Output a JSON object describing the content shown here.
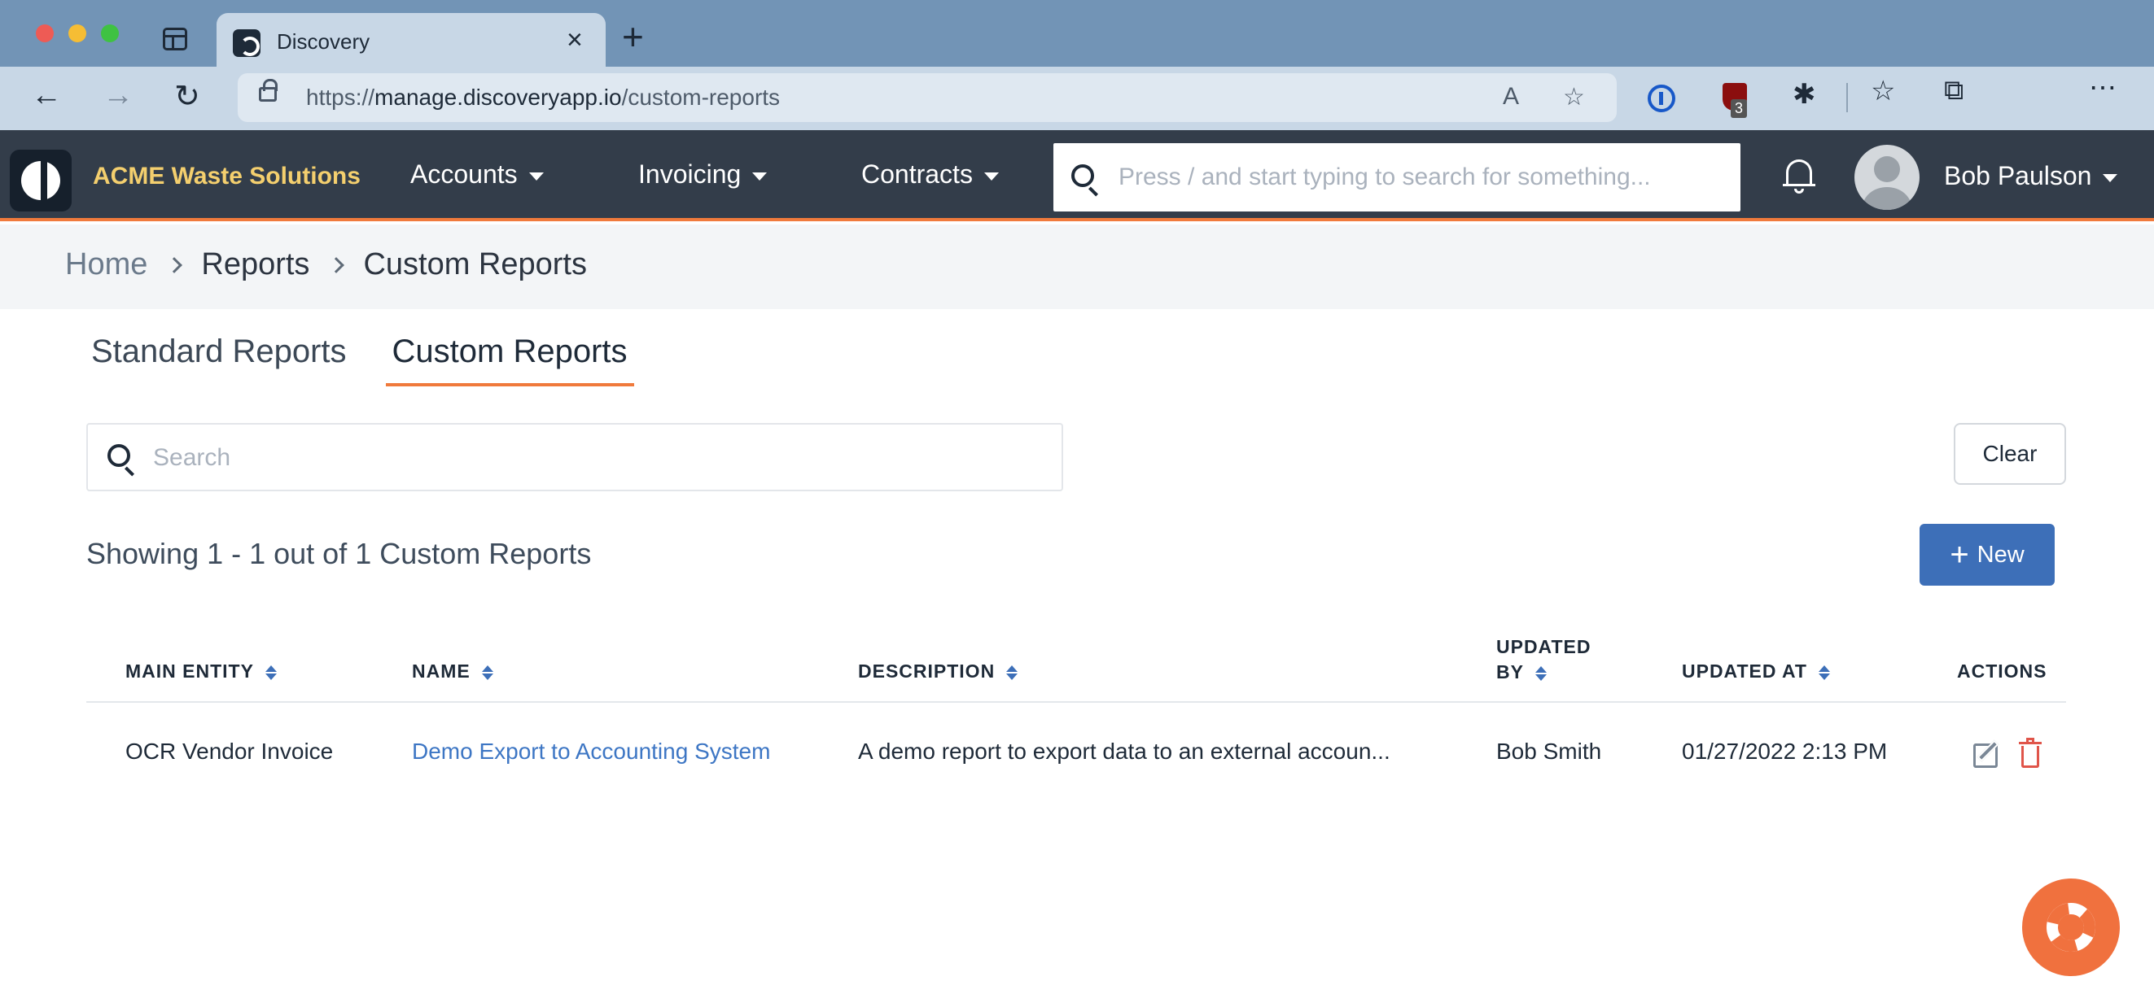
{
  "browser": {
    "tab_title": "Discovery",
    "url_prefix": "https://",
    "url_host": "manage.discoveryapp.io",
    "url_path": "/custom-reports",
    "extension_badge": "3",
    "icons": [
      "sidebar-icon",
      "back-icon",
      "forward-icon",
      "reload-icon",
      "lock-icon",
      "read-aloud-icon",
      "favorite-add-icon",
      "1password-icon",
      "ublock-icon",
      "extensions-icon",
      "favorites-icon",
      "collections-icon",
      "more-icon"
    ]
  },
  "header": {
    "company": "ACME Waste Solutions",
    "nav": [
      {
        "label": "Accounts"
      },
      {
        "label": "Invoicing"
      },
      {
        "label": "Contracts"
      }
    ],
    "search_placeholder": "Press / and start typing to search for something...",
    "user_name": "Bob Paulson",
    "accent_color": "#f07a3c"
  },
  "breadcrumb": [
    "Home",
    "Reports",
    "Custom Reports"
  ],
  "tabs": [
    {
      "label": "Standard Reports",
      "active": false
    },
    {
      "label": "Custom Reports",
      "active": true
    }
  ],
  "search": {
    "placeholder": "Search",
    "value": ""
  },
  "clear_label": "Clear",
  "showing_text": "Showing 1 - 1 out of 1 Custom Reports",
  "new_label": "New",
  "table": {
    "columns": [
      "MAIN ENTITY",
      "NAME",
      "DESCRIPTION",
      "UPDATED BY",
      "UPDATED AT",
      "ACTIONS"
    ],
    "updated_by_line1": "UPDATED",
    "updated_by_line2": "BY",
    "rows": [
      {
        "main_entity": "OCR Vendor Invoice",
        "name": "Demo Export to Accounting System",
        "description": "A demo report to export data to an external accoun...",
        "updated_by": "Bob Smith",
        "updated_at": "01/27/2022 2:13 PM"
      }
    ]
  },
  "colors": {
    "header_bg": "#333d4a",
    "primary": "#3d6fb8",
    "link": "#3d76c4",
    "delete": "#e0554a",
    "help": "#f0713e"
  }
}
